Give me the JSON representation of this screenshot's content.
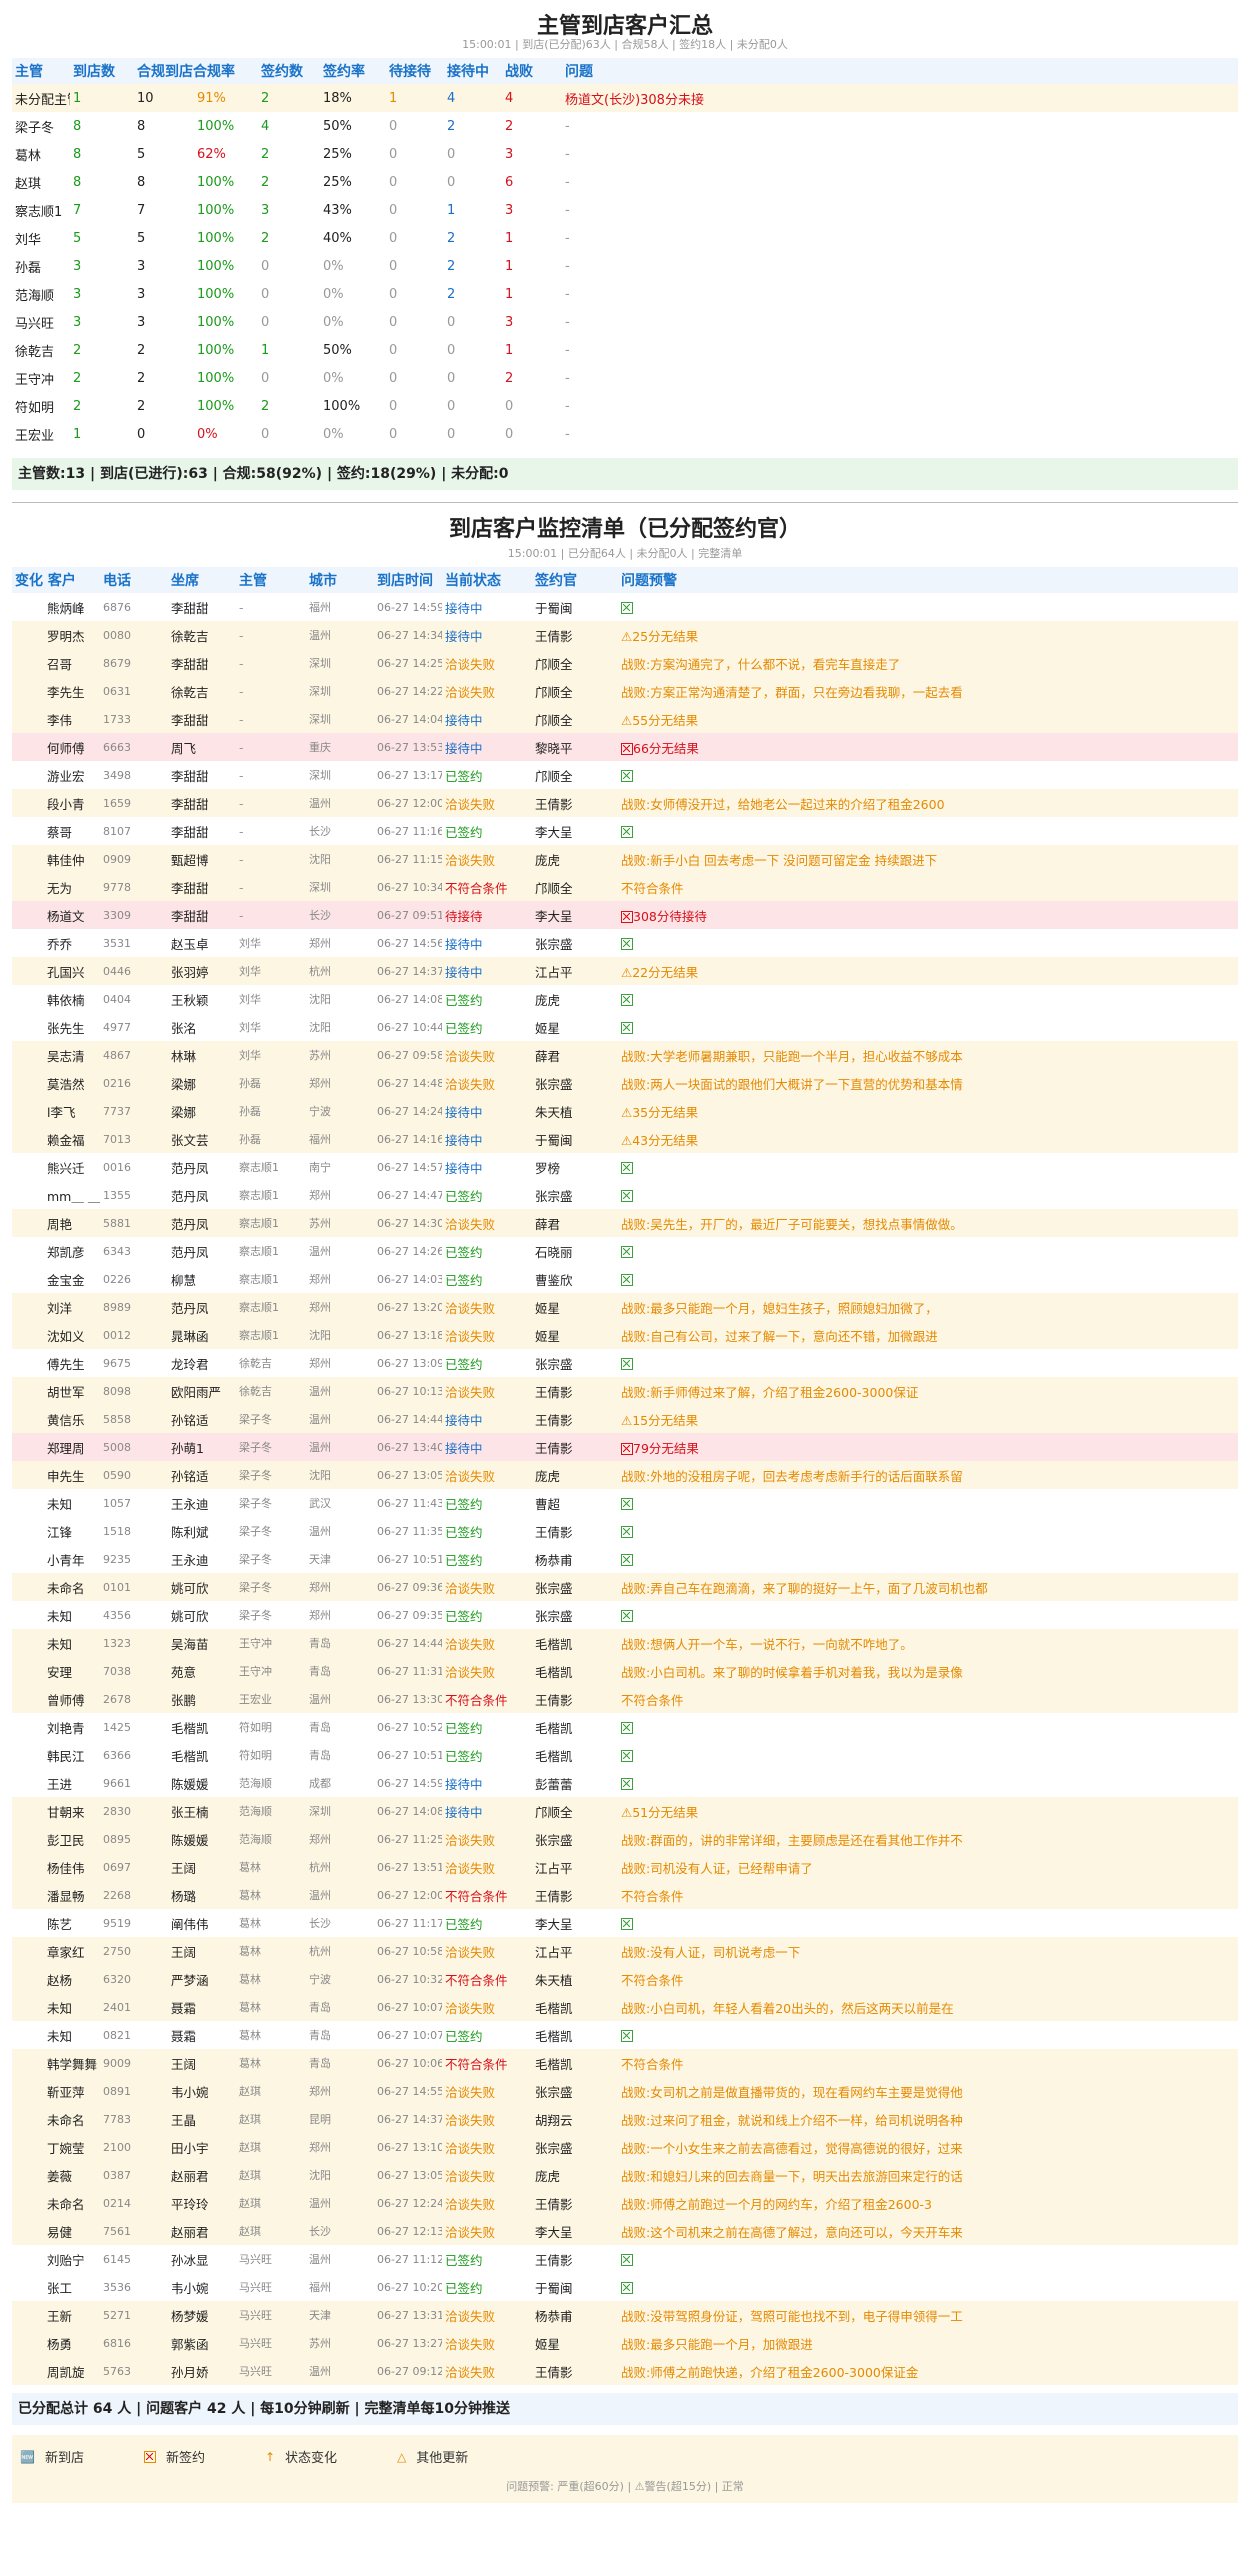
{
  "report1": {
    "title": "主管到店客户汇总",
    "subtitle": "15:00:01 | 到店(已分配)63人 | 合规58人 | 签约18人 | 未分配0人",
    "headers": [
      "主管",
      "到店数",
      "合规到店合规率",
      "签约数",
      "签约率",
      "待接待",
      "接待中",
      "战败",
      "问题"
    ],
    "rows": [
      [
        "未分配主管",
        "1",
        "10",
        "91%",
        "2",
        "18%",
        "1",
        "4",
        "4",
        "杨道文(长沙)308分未接"
      ],
      [
        "梁子冬",
        "8",
        "8",
        "100%",
        "4",
        "50%",
        "0",
        "2",
        "2",
        "-"
      ],
      [
        "葛林",
        "8",
        "5",
        "62%",
        "2",
        "25%",
        "0",
        "0",
        "3",
        "-"
      ],
      [
        "赵琪",
        "8",
        "8",
        "100%",
        "2",
        "25%",
        "0",
        "0",
        "6",
        "-"
      ],
      [
        "察志顺1",
        "7",
        "7",
        "100%",
        "3",
        "43%",
        "0",
        "1",
        "3",
        "-"
      ],
      [
        "刘华",
        "5",
        "5",
        "100%",
        "2",
        "40%",
        "0",
        "2",
        "1",
        "-"
      ],
      [
        "孙磊",
        "3",
        "3",
        "100%",
        "0",
        "0%",
        "0",
        "2",
        "1",
        "-"
      ],
      [
        "范海顺",
        "3",
        "3",
        "100%",
        "0",
        "0%",
        "0",
        "2",
        "1",
        "-"
      ],
      [
        "马兴旺",
        "3",
        "3",
        "100%",
        "0",
        "0%",
        "0",
        "0",
        "3",
        "-"
      ],
      [
        "徐乾吉",
        "2",
        "2",
        "100%",
        "1",
        "50%",
        "0",
        "0",
        "1",
        "-"
      ],
      [
        "王守冲",
        "2",
        "2",
        "100%",
        "0",
        "0%",
        "0",
        "0",
        "2",
        "-"
      ],
      [
        "符如明",
        "2",
        "2",
        "100%",
        "2",
        "100%",
        "0",
        "0",
        "0",
        "-"
      ],
      [
        "王宏业",
        "1",
        "0",
        "0%",
        "0",
        "0%",
        "0",
        "0",
        "0",
        "-"
      ]
    ],
    "summary": "主管数:13 | 到店(已进行):63 | 合规:58(92%) | 签约:18(29%) | 未分配:0"
  },
  "report2": {
    "title": "到店客户监控清单（已分配签约官）",
    "subtitle": "15:00:01 | 已分配64人 | 未分配0人 | 完整清单",
    "headers": [
      "变化 客户",
      "电话",
      "坐席",
      "主管",
      "城市",
      "到店时间",
      "当前状态",
      "签约官",
      "问题预警"
    ],
    "rows": [
      [
        "",
        "熊炳峰",
        "6876",
        "李甜甜",
        "-",
        "福州",
        "06-27 14:59",
        "接待中",
        "于蜀闽",
        "ok"
      ],
      [
        "",
        "罗明杰",
        "0080",
        "徐乾吉",
        "-",
        "温州",
        "06-27 14:34",
        "接待中",
        "王倩影",
        "⚠25分无结果"
      ],
      [
        "",
        "召哥",
        "8679",
        "李甜甜",
        "-",
        "深圳",
        "06-27 14:25",
        "洽谈失败",
        "邝顺全",
        "战败:方案沟通完了，什么都不说，看完车直接走了"
      ],
      [
        "",
        "李先生",
        "0631",
        "徐乾吉",
        "-",
        "深圳",
        "06-27 14:22",
        "洽谈失败",
        "邝顺全",
        "战败:方案正常沟通清楚了，群面，只在旁边看我聊，一起去看"
      ],
      [
        "",
        "李伟",
        "1733",
        "李甜甜",
        "-",
        "深圳",
        "06-27 14:04",
        "接待中",
        "邝顺全",
        "⚠55分无结果"
      ],
      [
        "",
        "何师傅",
        "6663",
        "周飞",
        "-",
        "重庆",
        "06-27 13:53",
        "接待中",
        "黎晓平",
        "66分无结果"
      ],
      [
        "",
        "游业宏",
        "3498",
        "李甜甜",
        "-",
        "深圳",
        "06-27 13:17",
        "已签约",
        "邝顺全",
        "ok"
      ],
      [
        "",
        "段小青",
        "1659",
        "李甜甜",
        "-",
        "温州",
        "06-27 12:00",
        "洽谈失败",
        "王倩影",
        "战败:女师傅没开过，给她老公一起过来的介绍了租金2600"
      ],
      [
        "",
        "蔡哥",
        "8107",
        "李甜甜",
        "-",
        "长沙",
        "06-27 11:16",
        "已签约",
        "李大呈",
        "ok"
      ],
      [
        "",
        "韩佳仲",
        "0909",
        "甄超博",
        "-",
        "沈阳",
        "06-27 11:15",
        "洽谈失败",
        "庞虎",
        "战败:新手小白 回去考虑一下 没问题可留定金 持续跟进下"
      ],
      [
        "",
        "无为",
        "9778",
        "李甜甜",
        "-",
        "深圳",
        "06-27 10:34",
        "不符合条件",
        "邝顺全",
        "不符合条件"
      ],
      [
        "",
        "杨道文",
        "3309",
        "李甜甜",
        "-",
        "长沙",
        "06-27 09:51",
        "待接待",
        "李大呈",
        "308分待接待"
      ],
      [
        "",
        "乔乔",
        "3531",
        "赵玉卓",
        "刘华",
        "郑州",
        "06-27 14:56",
        "接待中",
        "张宗盛",
        "ok"
      ],
      [
        "",
        "孔国兴",
        "0446",
        "张羽婷",
        "刘华",
        "杭州",
        "06-27 14:37",
        "接待中",
        "江占平",
        "⚠22分无结果"
      ],
      [
        "",
        "韩依楠",
        "0404",
        "王秋颖",
        "刘华",
        "沈阳",
        "06-27 14:08",
        "已签约",
        "庞虎",
        "ok"
      ],
      [
        "",
        "张先生",
        "4977",
        "张洺",
        "刘华",
        "沈阳",
        "06-27 10:44",
        "已签约",
        "姬星",
        "ok"
      ],
      [
        "",
        "吴志清",
        "4867",
        "林琳",
        "刘华",
        "苏州",
        "06-27 09:58",
        "洽谈失败",
        "薛君",
        "战败:大学老师暑期兼职，只能跑一个半月，担心收益不够成本"
      ],
      [
        "",
        "莫浩然",
        "0216",
        "梁娜",
        "孙磊",
        "郑州",
        "06-27 14:48",
        "洽谈失败",
        "张宗盛",
        "战败:两人一块面试的跟他们大概讲了一下直营的优势和基本情"
      ],
      [
        "",
        "l李飞",
        "7737",
        "梁娜",
        "孙磊",
        "宁波",
        "06-27 14:24",
        "接待中",
        "朱天植",
        "⚠35分无结果"
      ],
      [
        "",
        "赖金福",
        "7013",
        "张文芸",
        "孙磊",
        "福州",
        "06-27 14:16",
        "接待中",
        "于蜀闽",
        "⚠43分无结果"
      ],
      [
        "",
        "熊兴迁",
        "0016",
        "范丹凤",
        "察志顺1",
        "南宁",
        "06-27 14:57",
        "接待中",
        "罗榜",
        "ok"
      ],
      [
        "",
        "mm＿ ＿",
        "1355",
        "范丹凤",
        "察志顺1",
        "郑州",
        "06-27 14:47",
        "已签约",
        "张宗盛",
        "ok"
      ],
      [
        "",
        "周艳",
        "5881",
        "范丹凤",
        "察志顺1",
        "苏州",
        "06-27 14:30",
        "洽谈失败",
        "薛君",
        "战败:吴先生，开厂的，最近厂子可能要关，想找点事情做做。"
      ],
      [
        "",
        "郑凯彦",
        "6343",
        "范丹凤",
        "察志顺1",
        "温州",
        "06-27 14:26",
        "已签约",
        "石晓丽",
        "ok"
      ],
      [
        "",
        "金宝金",
        "0226",
        "柳慧",
        "察志顺1",
        "郑州",
        "06-27 14:03",
        "已签约",
        "曹鉴欣",
        "ok"
      ],
      [
        "",
        "刘洋",
        "8989",
        "范丹凤",
        "察志顺1",
        "郑州",
        "06-27 13:20",
        "洽谈失败",
        "姬星",
        "战败:最多只能跑一个月，媳妇生孩子，照顾媳妇加微了，"
      ],
      [
        "",
        "沈如义",
        "0012",
        "晁琳函",
        "察志顺1",
        "沈阳",
        "06-27 13:18",
        "洽谈失败",
        "姬星",
        "战败:自己有公司，过来了解一下，意向还不错，加微跟进"
      ],
      [
        "",
        "傅先生",
        "9675",
        "龙玲君",
        "徐乾吉",
        "郑州",
        "06-27 13:09",
        "已签约",
        "张宗盛",
        "ok"
      ],
      [
        "",
        "胡世军",
        "8098",
        "欧阳雨严",
        "徐乾吉",
        "温州",
        "06-27 10:13",
        "洽谈失败",
        "王倩影",
        "战败:新手师傅过来了解，介绍了租金2600-3000保证"
      ],
      [
        "",
        "黄信乐",
        "5858",
        "孙铭适",
        "梁子冬",
        "温州",
        "06-27 14:44",
        "接待中",
        "王倩影",
        "⚠15分无结果"
      ],
      [
        "",
        "郑理周",
        "5008",
        "孙萌1",
        "梁子冬",
        "温州",
        "06-27 13:40",
        "接待中",
        "王倩影",
        "79分无结果"
      ],
      [
        "",
        "申先生",
        "0590",
        "孙铭适",
        "梁子冬",
        "沈阳",
        "06-27 13:05",
        "洽谈失败",
        "庞虎",
        "战败:外地的没租房子呢，回去考虑考虑新手行的话后面联系留"
      ],
      [
        "",
        "未知",
        "1057",
        "王永迪",
        "梁子冬",
        "武汉",
        "06-27 11:43",
        "已签约",
        "曹超",
        "ok"
      ],
      [
        "",
        "江锋",
        "1518",
        "陈利斌",
        "梁子冬",
        "温州",
        "06-27 11:35",
        "已签约",
        "王倩影",
        "ok"
      ],
      [
        "",
        "小青年",
        "9235",
        "王永迪",
        "梁子冬",
        "天津",
        "06-27 10:51",
        "已签约",
        "杨恭甫",
        "ok"
      ],
      [
        "",
        "未命名",
        "0101",
        "姚可欣",
        "梁子冬",
        "郑州",
        "06-27 09:36",
        "洽谈失败",
        "张宗盛",
        "战败:弄自己车在跑滴滴，来了聊的挺好一上午，面了几波司机也都"
      ],
      [
        "",
        "未知",
        "4356",
        "姚可欣",
        "梁子冬",
        "郑州",
        "06-27 09:35",
        "已签约",
        "张宗盛",
        "ok"
      ],
      [
        "",
        "未知",
        "1323",
        "吴海苗",
        "王守冲",
        "青岛",
        "06-27 14:44",
        "洽谈失败",
        "毛楷凯",
        "战败:想俩人开一个车，一说不行，一向就不咋地了。"
      ],
      [
        "",
        "安理",
        "7038",
        "苑意",
        "王守冲",
        "青岛",
        "06-27 11:31",
        "洽谈失败",
        "毛楷凯",
        "战败:小白司机。来了聊的时候拿着手机对着我，我以为是录像"
      ],
      [
        "",
        "曾师傅",
        "2678",
        "张鹏",
        "王宏业",
        "温州",
        "06-27 13:30",
        "不符合条件",
        "王倩影",
        "不符合条件"
      ],
      [
        "",
        "刘艳青",
        "1425",
        "毛楷凯",
        "符如明",
        "青岛",
        "06-27 10:52",
        "已签约",
        "毛楷凯",
        "ok"
      ],
      [
        "",
        "韩民江",
        "6366",
        "毛楷凯",
        "符如明",
        "青岛",
        "06-27 10:51",
        "已签约",
        "毛楷凯",
        "ok"
      ],
      [
        "",
        "王进",
        "9661",
        "陈媛媛",
        "范海顺",
        "成都",
        "06-27 14:59",
        "接待中",
        "彭蕾蕾",
        "ok"
      ],
      [
        "",
        "甘朝来",
        "2830",
        "张王楠",
        "范海顺",
        "深圳",
        "06-27 14:08",
        "接待中",
        "邝顺全",
        "⚠51分无结果"
      ],
      [
        "",
        "彭卫民",
        "0895",
        "陈媛媛",
        "范海顺",
        "郑州",
        "06-27 11:25",
        "洽谈失败",
        "张宗盛",
        "战败:群面的，讲的非常详细，主要顾虑是还在看其他工作并不"
      ],
      [
        "",
        "杨佳伟",
        "0697",
        "王阔",
        "葛林",
        "杭州",
        "06-27 13:51",
        "洽谈失败",
        "江占平",
        "战败:司机没有人证，已经帮申请了"
      ],
      [
        "",
        "潘显畅",
        "2268",
        "杨璐",
        "葛林",
        "温州",
        "06-27 12:00",
        "不符合条件",
        "王倩影",
        "不符合条件"
      ],
      [
        "",
        "陈艺",
        "9519",
        "阐伟伟",
        "葛林",
        "长沙",
        "06-27 11:17",
        "已签约",
        "李大呈",
        "ok"
      ],
      [
        "",
        "章家红",
        "2750",
        "王阔",
        "葛林",
        "杭州",
        "06-27 10:58",
        "洽谈失败",
        "江占平",
        "战败:没有人证，司机说考虑一下"
      ],
      [
        "",
        "赵杨",
        "6320",
        "严梦涵",
        "葛林",
        "宁波",
        "06-27 10:32",
        "不符合条件",
        "朱天植",
        "不符合条件"
      ],
      [
        "",
        "未知",
        "2401",
        "聂霜",
        "葛林",
        "青岛",
        "06-27 10:07",
        "洽谈失败",
        "毛楷凯",
        "战败:小白司机，年轻人看着20出头的，然后这两天以前是在"
      ],
      [
        "",
        "未知",
        "0821",
        "聂霜",
        "葛林",
        "青岛",
        "06-27 10:07",
        "已签约",
        "毛楷凯",
        "ok"
      ],
      [
        "",
        "韩学舞舞",
        "9009",
        "王阔",
        "葛林",
        "青岛",
        "06-27 10:06",
        "不符合条件",
        "毛楷凯",
        "不符合条件"
      ],
      [
        "",
        "靳亚萍",
        "0891",
        "韦小婉",
        "赵琪",
        "郑州",
        "06-27 14:55",
        "洽谈失败",
        "张宗盛",
        "战败:女司机之前是做直播带货的，现在看网约车主要是觉得他"
      ],
      [
        "",
        "未命名",
        "7783",
        "王晶",
        "赵琪",
        "昆明",
        "06-27 14:37",
        "洽谈失败",
        "胡翔云",
        "战败:过来问了租金，就说和线上介绍不一样，给司机说明各种"
      ],
      [
        "",
        "丁婉莹",
        "2100",
        "田小宇",
        "赵琪",
        "郑州",
        "06-27 13:10",
        "洽谈失败",
        "张宗盛",
        "战败:一个小女生来之前去高德看过，觉得高德说的很好，过来"
      ],
      [
        "",
        "姜薇",
        "0387",
        "赵丽君",
        "赵琪",
        "沈阳",
        "06-27 13:05",
        "洽谈失败",
        "庞虎",
        "战败:和媳妇儿来的回去商量一下，明天出去旅游回来定行的话"
      ],
      [
        "",
        "未命名",
        "0214",
        "平玲玲",
        "赵琪",
        "温州",
        "06-27 12:24",
        "洽谈失败",
        "王倩影",
        "战败:师傅之前跑过一个月的网约车，介绍了租金2600-3"
      ],
      [
        "",
        "易健",
        "7561",
        "赵丽君",
        "赵琪",
        "长沙",
        "06-27 12:13",
        "洽谈失败",
        "李大呈",
        "战败:这个司机来之前在高德了解过，意向还可以，今天开车来"
      ],
      [
        "",
        "刘贻宁",
        "6145",
        "孙冰显",
        "马兴旺",
        "温州",
        "06-27 11:12",
        "已签约",
        "王倩影",
        "ok"
      ],
      [
        "",
        "张工",
        "3536",
        "韦小婉",
        "马兴旺",
        "福州",
        "06-27 10:20",
        "已签约",
        "于蜀闽",
        "ok"
      ],
      [
        "",
        "王新",
        "5271",
        "杨梦媛",
        "马兴旺",
        "天津",
        "06-27 13:31",
        "洽谈失败",
        "杨恭甫",
        "战败:没带驾照身份证，驾照可能也找不到，电子得申领得一工"
      ],
      [
        "",
        "杨勇",
        "6816",
        "郭紫函",
        "马兴旺",
        "苏州",
        "06-27 13:27",
        "洽谈失败",
        "姬星",
        "战败:最多只能跑一个月，加微跟进"
      ],
      [
        "",
        "周凯旋",
        "5763",
        "孙月娇",
        "马兴旺",
        "温州",
        "06-27 09:12",
        "洽谈失败",
        "王倩影",
        "战败:师傅之前跑快递，介绍了租金2600-3000保证金"
      ]
    ],
    "footer": "已分配总计 64 人 | 问题客户 42 人 | 每10分钟刷新 | 完整清单每10分钟推送"
  },
  "legend": {
    "items": [
      "新到店",
      "新签约",
      "状态变化",
      "其他更新"
    ],
    "note": "问题预警: 严重(超60分) | ⚠警告(超15分) | 正常"
  },
  "colors": {
    "header": "#1a73c9",
    "green": "#1a9a1a",
    "orange": "#e68a00",
    "red": "#d8101a",
    "blue": "#1a6fc9"
  }
}
